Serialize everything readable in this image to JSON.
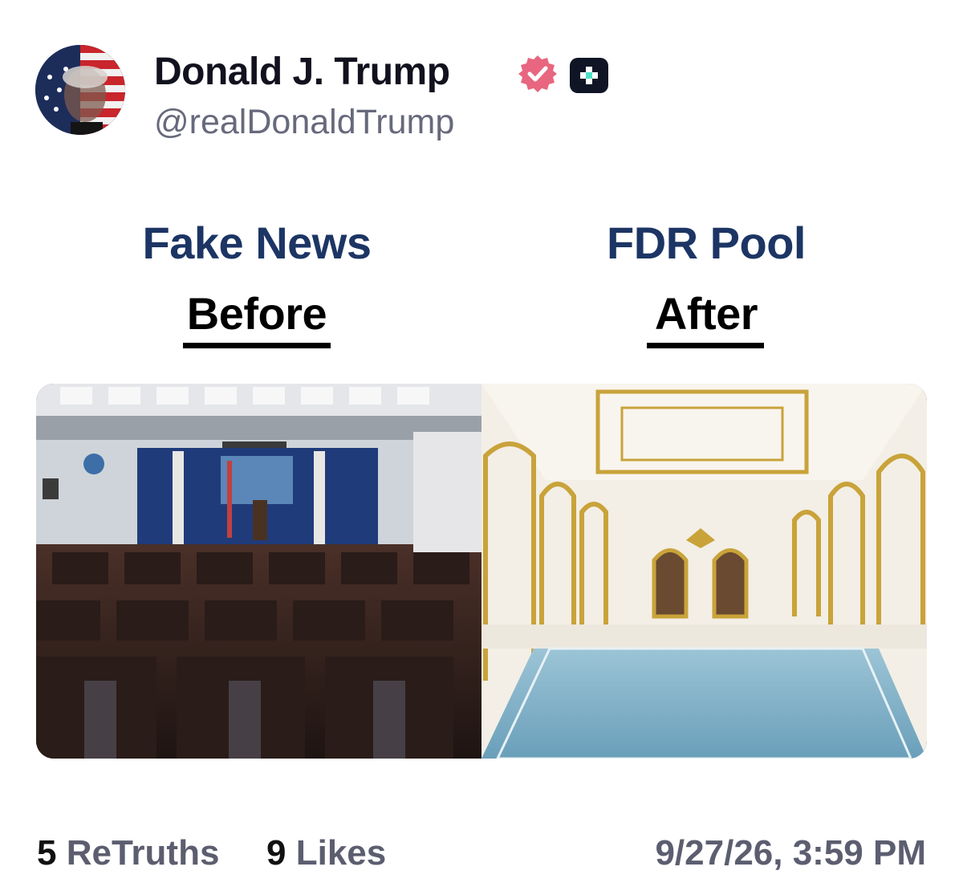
{
  "post": {
    "author": {
      "display_name": "Donald J. Trump",
      "handle": "@realDonaldTrump",
      "avatar_icon": "flag-portrait-avatar",
      "verified_icon": "verified-badge-icon",
      "plus_icon": "plus-badge-icon",
      "verified_color": "#e8667f"
    },
    "media": {
      "left": {
        "title": "Fake News",
        "label": "Before"
      },
      "right": {
        "title": "FDR Pool",
        "label": "After"
      },
      "heading_color": "#1c3564"
    },
    "stats": {
      "retruths_count": "5",
      "retruths_label": "ReTruths",
      "likes_count": "9",
      "likes_label": "Likes"
    },
    "timestamp": "9/27/26, 3:59 PM"
  }
}
